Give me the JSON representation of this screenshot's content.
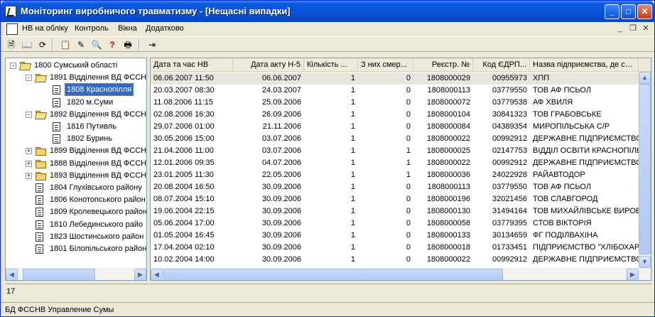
{
  "window": {
    "title": "Моніторинг виробничого травматизму - [Нещасні випадки]"
  },
  "menu": {
    "items": [
      "НВ на обліку",
      "Контроль",
      "Вікна",
      "Додатково"
    ]
  },
  "toolbar": {
    "icons": [
      "document-icon",
      "open-book-icon",
      "refresh-icon",
      "add-record-icon",
      "edit-record-icon",
      "search-icon",
      "help-icon",
      "print-icon",
      "exit-icon"
    ],
    "help_glyph": "?"
  },
  "tree": {
    "nodes": [
      {
        "code": "1800  Сумський області",
        "level": 0,
        "icon": "folder-open",
        "expander": "-"
      },
      {
        "code": "1891 Відділення ВД ФССН",
        "level": 1,
        "icon": "folder-open",
        "expander": "-"
      },
      {
        "code": "1808 Краснопілля",
        "level": 2,
        "icon": "doc",
        "selected": true
      },
      {
        "code": "1820 м.Суми",
        "level": 2,
        "icon": "doc"
      },
      {
        "code": "1892 Відділення ВД ФССН",
        "level": 1,
        "icon": "folder-open",
        "expander": "-"
      },
      {
        "code": "1816 Путивль",
        "level": 2,
        "icon": "doc"
      },
      {
        "code": "1802 Буринь",
        "level": 2,
        "icon": "doc"
      },
      {
        "code": "1899 Відділення ВД ФССН",
        "level": 1,
        "icon": "folder",
        "expander": "+"
      },
      {
        "code": "1888 Відділення ВД ФССН",
        "level": 1,
        "icon": "folder",
        "expander": "+"
      },
      {
        "code": "1893 Відділення ВД ФССН",
        "level": 1,
        "icon": "folder",
        "expander": "+"
      },
      {
        "code": "1804 Глухівського району",
        "level": 1,
        "icon": "doc"
      },
      {
        "code": "1806 Конотопського район",
        "level": 1,
        "icon": "doc"
      },
      {
        "code": "1809 Кролевецького район",
        "level": 1,
        "icon": "doc"
      },
      {
        "code": "1810 Лебединського райо",
        "level": 1,
        "icon": "doc"
      },
      {
        "code": "1823 Шостинського район",
        "level": 1,
        "icon": "doc"
      },
      {
        "code": "1801 Білопільського район",
        "level": 1,
        "icon": "doc"
      }
    ]
  },
  "grid": {
    "columns": [
      "Дата та час НВ",
      "Дата акту Н-5",
      "Кількість ...",
      "З них смер...",
      "Реєстр. №",
      "Код ЄДРП...",
      "Назва підприємства, де став"
    ],
    "rows": [
      [
        "06.06.2007 11:50",
        "06.06.2007",
        "1",
        "0",
        "1808000029",
        "00955973",
        "ХПП"
      ],
      [
        "20.03.2007 08:30",
        "24.03.2007",
        "1",
        "0",
        "1808000113",
        "03779550",
        "ТОВ АФ ПСЬОЛ"
      ],
      [
        "11.08.2006 11:15",
        "25.09.2006",
        "1",
        "0",
        "1808000072",
        "03779538",
        "АФ ХВИЛЯ"
      ],
      [
        "02.08.2006 16:30",
        "26.09.2006",
        "1",
        "0",
        "1808000104",
        "30841323",
        "ТОВ ГРАБОВСЬКЕ"
      ],
      [
        "29.07.2006 01:00",
        "21.11.2006",
        "1",
        "0",
        "1808000084",
        "04389354",
        "МИРОПІЛЬСЬКА С/Р"
      ],
      [
        "30.05.2006 15:00",
        "03.07.2006",
        "1",
        "0",
        "1808000022",
        "00992912",
        "ДЕРЖАВНЕ ПІДПРИЄМСТВО\"К"
      ],
      [
        "21.04.2006 11:00",
        "03.07.2006",
        "1",
        "1",
        "1808000025",
        "02147753",
        "ВІДДІЛ ОСВІТИ КРАСНОПІЛЬ"
      ],
      [
        "12.01.2006 09:35",
        "04.07.2006",
        "1",
        "1",
        "1808000022",
        "00992912",
        "ДЕРЖАВНЕ ПІДПРИЄМСТВО\"К"
      ],
      [
        "23.01.2005 11:30",
        "22.05.2006",
        "1",
        "1",
        "1808000036",
        "24022928",
        "РАЙАВТОДОР"
      ],
      [
        "20.08.2004 16:50",
        "30.09.2006",
        "1",
        "0",
        "1808000113",
        "03779550",
        "ТОВ АФ ПСЬОЛ"
      ],
      [
        "08.07.2004 15:10",
        "30.09.2006",
        "1",
        "0",
        "1808000196",
        "32021456",
        "ТОВ СЛАВГОРОД"
      ],
      [
        "19.06.2004 22:15",
        "30.09.2006",
        "1",
        "0",
        "1808000130",
        "31494164",
        "ТОВ МИХАЙЛІВСЬКЕ ВИРОБНІ"
      ],
      [
        "05.06.2004 17:00",
        "30.09.2006",
        "1",
        "0",
        "1808000058",
        "03779395",
        "СТОВ ВІКТОРІЯ"
      ],
      [
        "01.05.2004 16:45",
        "30.09.2006",
        "1",
        "0",
        "1808000133",
        "30134659",
        "ФГ ПОДІЛВАХІНА"
      ],
      [
        "17.04.2004 02:10",
        "30.09.2006",
        "1",
        "0",
        "1808000018",
        "01733451",
        "ПІДПРИЄМСТВО  \"ХЛІБОХАРЧ"
      ],
      [
        "10.02.2004 14:00",
        "30.09.2006",
        "1",
        "0",
        "1808000022",
        "00992912",
        "ДЕРЖАВНЕ ПІДПРИЄМСТВО\"К"
      ]
    ]
  },
  "status": {
    "count": "17",
    "db": "БД ФССНВ Управление Сумы"
  },
  "colors": {
    "selection": "#316ac5",
    "title_bar": "#0a5ae0"
  }
}
